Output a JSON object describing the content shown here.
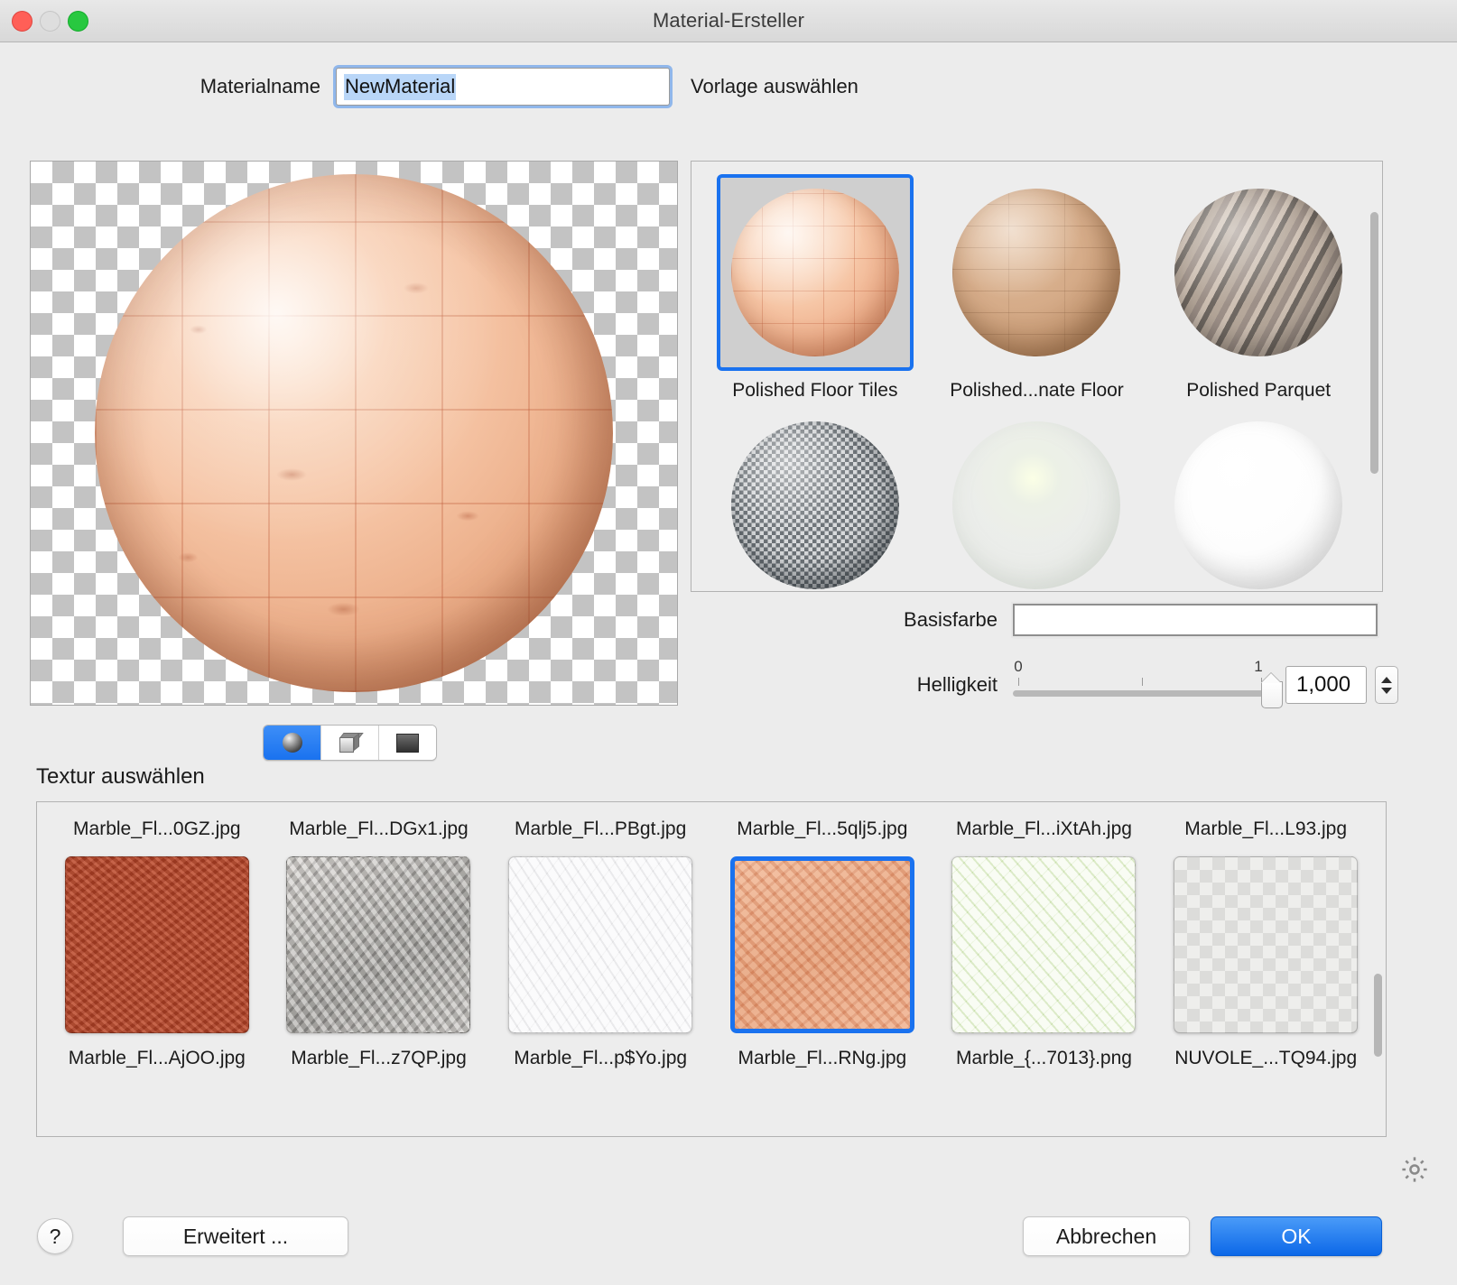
{
  "window": {
    "title": "Material-Ersteller",
    "traffic_lights": [
      "close",
      "minimize",
      "zoom"
    ]
  },
  "material_name": {
    "label": "Materialname",
    "value": "NewMaterial",
    "selected": true
  },
  "template_section": {
    "label": "Vorlage auswählen",
    "items": [
      {
        "label": "Polished Floor Tiles",
        "swatch": "v-tiles",
        "selected": true
      },
      {
        "label": "Polished...nate Floor",
        "swatch": "v-laminate",
        "selected": false
      },
      {
        "label": "Polished Parquet",
        "swatch": "v-parquet",
        "selected": false
      },
      {
        "label": "",
        "swatch": "v-grey",
        "selected": false
      },
      {
        "label": "",
        "swatch": "v-glass",
        "selected": false
      },
      {
        "label": "",
        "swatch": "v-white",
        "selected": false
      }
    ]
  },
  "base_color": {
    "label": "Basisfarbe",
    "value_hex": "#FFFFFF"
  },
  "brightness": {
    "label": "Helligkeit",
    "value": "1,000",
    "min_label": "0",
    "max_label": "1",
    "min": 0,
    "max": 1,
    "position_pct": 95
  },
  "preview": {
    "shape_modes": [
      {
        "icon": "sphere-icon",
        "selected": true
      },
      {
        "icon": "cube-icon",
        "selected": false
      },
      {
        "icon": "plane-icon",
        "selected": false
      }
    ]
  },
  "texture_section": {
    "label": "Textur auswählen",
    "items": [
      {
        "name": "Marble_Fl...0GZ.jpg",
        "swatch": "t-red",
        "selected": false,
        "row": "top"
      },
      {
        "name": "Marble_Fl...DGx1.jpg",
        "swatch": "t-grey",
        "selected": false,
        "row": "top"
      },
      {
        "name": "Marble_Fl...PBgt.jpg",
        "swatch": "t-white",
        "selected": false,
        "row": "top"
      },
      {
        "name": "Marble_Fl...5qlj5.jpg",
        "swatch": "t-orange",
        "selected": false,
        "row": "top"
      },
      {
        "name": "Marble_Fl...iXtAh.jpg",
        "swatch": "t-green",
        "selected": false,
        "row": "top"
      },
      {
        "name": "Marble_Fl...L93.jpg",
        "swatch": "t-mosaic",
        "selected": false,
        "row": "top"
      }
    ],
    "bottom_labels": [
      "Marble_Fl...AjOO.jpg",
      "Marble_Fl...z7QP.jpg",
      "Marble_Fl...p$Yo.jpg",
      "Marble_Fl...RNg.jpg",
      "Marble_{...7013}.png",
      "NUVOLE_...TQ94.jpg"
    ],
    "selected_index": 3
  },
  "footer": {
    "help_label": "?",
    "advanced_label": "Erweitert ...",
    "cancel_label": "Abbrechen",
    "ok_label": "OK"
  },
  "accent_color": "#1a72ef"
}
